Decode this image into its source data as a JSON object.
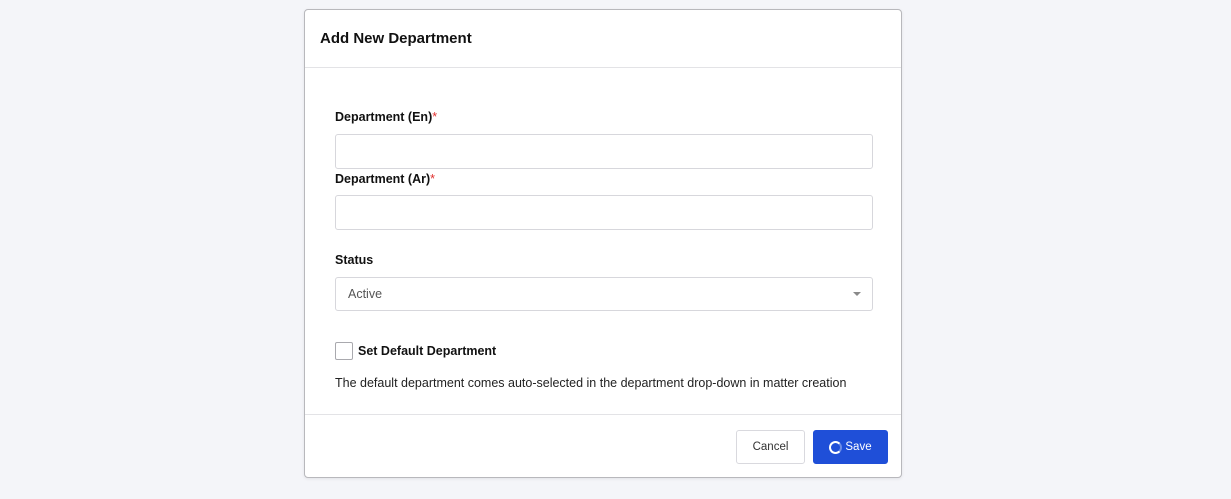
{
  "dialog": {
    "title": "Add New Department"
  },
  "form": {
    "department_en": {
      "label": "Department (En)",
      "required_mark": "*",
      "value": "",
      "placeholder": ""
    },
    "department_ar": {
      "label": "Department (Ar)",
      "required_mark": "*",
      "value": "",
      "placeholder": ""
    },
    "status": {
      "label": "Status",
      "selected": "Active"
    },
    "default_department": {
      "label": "Set Default Department",
      "checked": false,
      "help_text": "The default department comes auto-selected in the department drop-down in matter creation"
    }
  },
  "footer": {
    "cancel_label": "Cancel",
    "save_label": "Save",
    "save_icon": "spinner-icon"
  },
  "colors": {
    "primary": "#1f4fd8",
    "required": "#e0302e",
    "page_background": "#f4f5f9"
  }
}
